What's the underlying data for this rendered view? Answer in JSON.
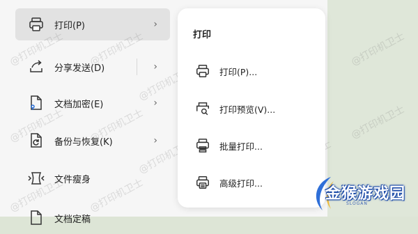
{
  "menu": {
    "items": [
      {
        "label": "打印(P)",
        "icon": "printer-icon",
        "has_submenu": true,
        "selected": true
      },
      {
        "label": "分享发送(D)",
        "icon": "share-icon",
        "has_submenu": true,
        "selected": false
      },
      {
        "label": "文档加密(E)",
        "icon": "encrypt-document-icon",
        "has_submenu": true,
        "selected": false
      },
      {
        "label": "备份与恢复(K)",
        "icon": "backup-icon",
        "has_submenu": true,
        "selected": false
      },
      {
        "label": "文件瘦身",
        "icon": "compress-icon",
        "has_submenu": false,
        "selected": false
      },
      {
        "label": "文档定稿",
        "icon": "finalize-icon",
        "has_submenu": false,
        "selected": false
      }
    ],
    "chevron": "›"
  },
  "submenu": {
    "title": "打印",
    "items": [
      {
        "label": "打印(P)...",
        "icon": "printer-icon"
      },
      {
        "label": "打印预览(V)...",
        "icon": "print-preview-icon"
      },
      {
        "label": "批量打印...",
        "icon": "batch-print-icon"
      },
      {
        "label": "高级打印...",
        "icon": "advanced-print-icon"
      }
    ]
  },
  "watermark": "@打印机卫士",
  "logo": {
    "text": "金猴游戏园",
    "sub": "SLOGAN"
  },
  "colors": {
    "background": "#dde5d6",
    "panel": "#f6f6f6",
    "selected_row": "#e2e2e2",
    "submenu_bg": "#ffffff",
    "logo_blue": "#1b4aa8"
  }
}
